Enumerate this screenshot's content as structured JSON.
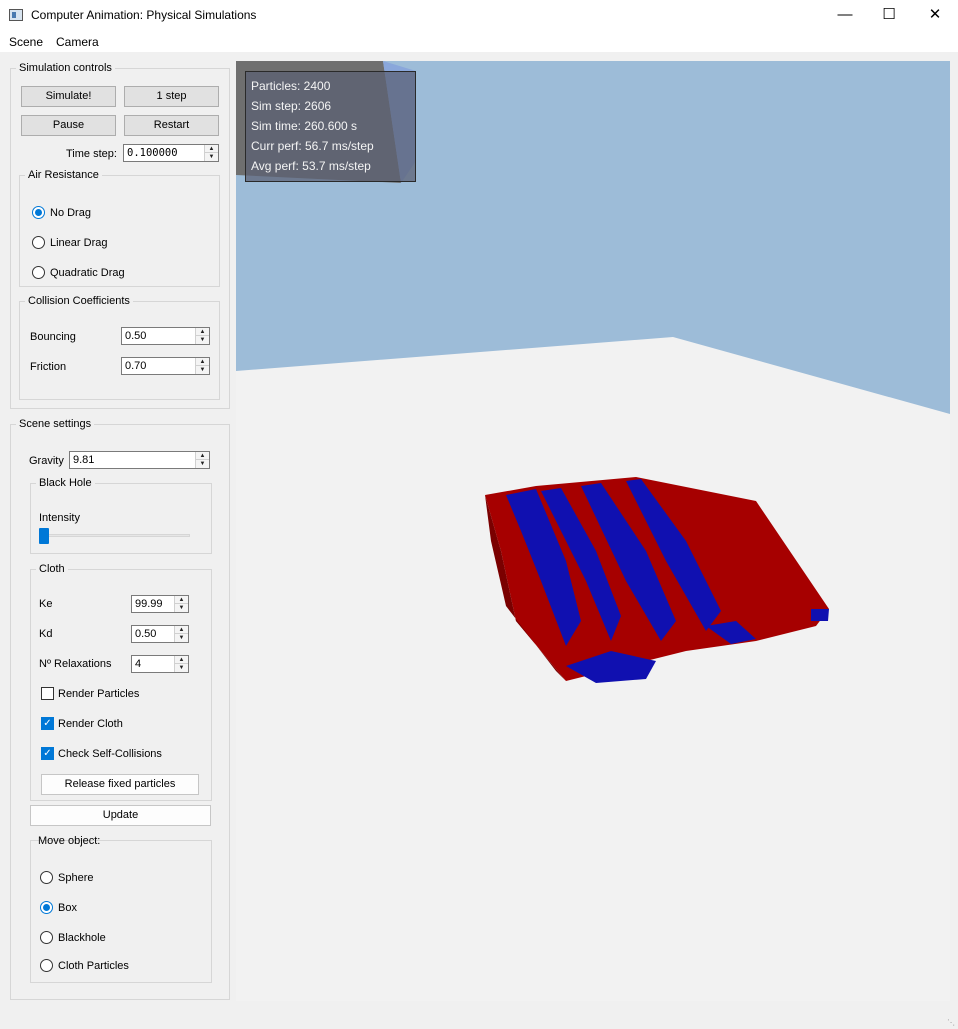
{
  "window": {
    "title": "Computer Animation: Physical Simulations"
  },
  "menu": {
    "scene": "Scene",
    "camera": "Camera"
  },
  "sim_controls": {
    "title": "Simulation controls",
    "simulate": "Simulate!",
    "one_step": "1 step",
    "pause": "Pause",
    "restart": "Restart",
    "time_step_label": "Time step:",
    "time_step_value": "0.100000"
  },
  "air_resistance": {
    "title": "Air Resistance",
    "options": [
      "No Drag",
      "Linear Drag",
      "Quadratic Drag"
    ],
    "selected": "No Drag"
  },
  "collision": {
    "title": "Collision Coefficients",
    "bouncing_label": "Bouncing",
    "bouncing_value": "0.50",
    "friction_label": "Friction",
    "friction_value": "0.70"
  },
  "scene_settings": {
    "title": "Scene settings",
    "gravity_label": "Gravity",
    "gravity_value": "9.81",
    "black_hole": {
      "title": "Black Hole",
      "intensity_label": "Intensity",
      "intensity_level": 0.0
    },
    "cloth": {
      "title": "Cloth",
      "ke_label": "Ke",
      "ke_value": "99.99",
      "kd_label": "Kd",
      "kd_value": "0.50",
      "relax_label": "Nº Relaxations",
      "relax_value": "4",
      "render_particles": "Render Particles",
      "render_particles_checked": false,
      "render_cloth": "Render Cloth",
      "render_cloth_checked": true,
      "self_collisions": "Check Self-Collisions",
      "self_collisions_checked": true,
      "release": "Release fixed particles"
    },
    "update": "Update",
    "move_object": {
      "title": "Move object:",
      "options": [
        "Sphere",
        "Box",
        "Blackhole",
        "Cloth Particles"
      ],
      "selected": "Box"
    }
  },
  "stats": {
    "particles": "Particles: 2400",
    "sim_step": "Sim step:  2606",
    "sim_time": "Sim time:  260.600 s",
    "curr_perf": "Curr perf: 56.7 ms/step",
    "avg_perf": "Avg perf:  53.7 ms/step"
  },
  "colors": {
    "sky": "#9dbcd8",
    "floor": "#f2f2f2",
    "cloth_red": "#a60000",
    "cloth_blue": "#1010b0",
    "accent": "#0078d7"
  }
}
